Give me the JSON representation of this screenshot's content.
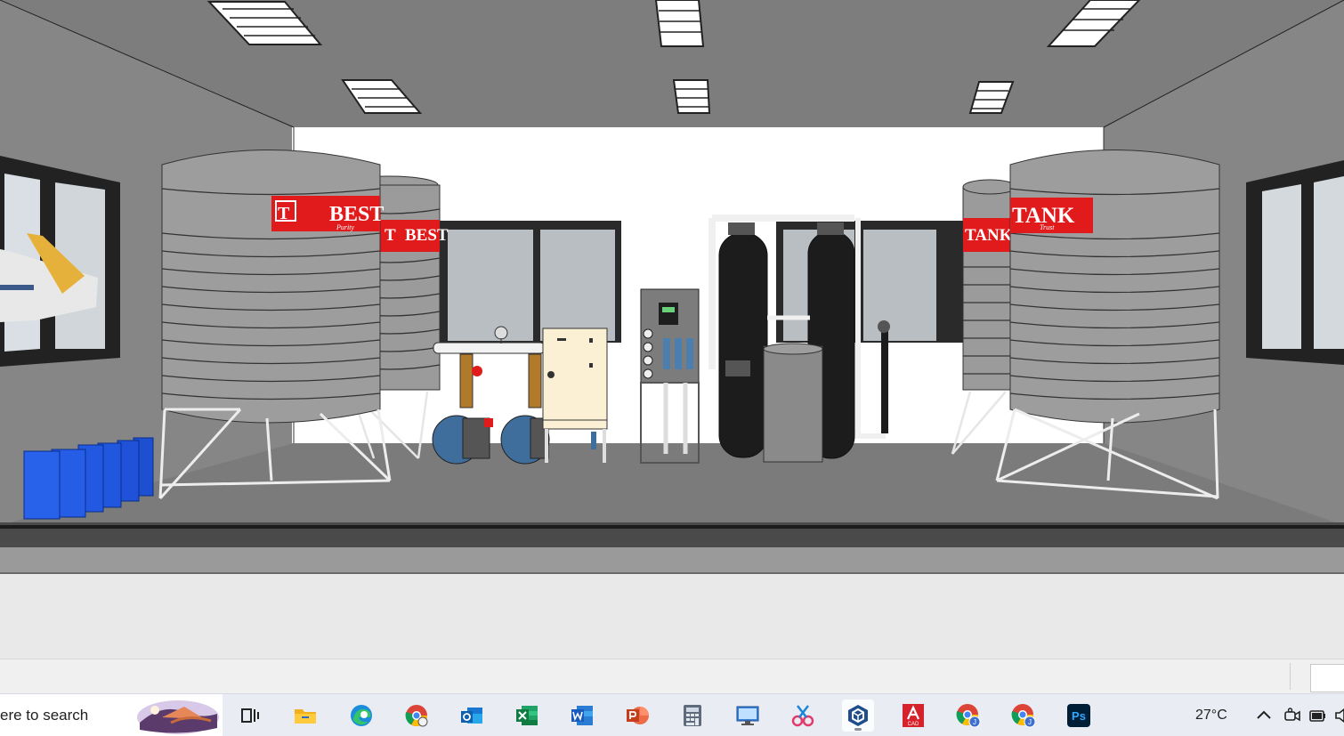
{
  "scene": {
    "tank_left_brand": "BEST",
    "tank_left_tagline": "Purity",
    "tank_right_brand": "TANK",
    "tank_right_tagline": "Trust"
  },
  "taskbar": {
    "search_text": "ere to search",
    "apps": [
      {
        "name": "task-view"
      },
      {
        "name": "file-explorer"
      },
      {
        "name": "edge"
      },
      {
        "name": "chrome-profile"
      },
      {
        "name": "outlook"
      },
      {
        "name": "excel"
      },
      {
        "name": "word"
      },
      {
        "name": "powerpoint"
      },
      {
        "name": "calculator"
      },
      {
        "name": "remote-desktop"
      },
      {
        "name": "snipping-tool"
      },
      {
        "name": "sketchup"
      },
      {
        "name": "autocad",
        "label": "CAD"
      },
      {
        "name": "chrome-user-1",
        "label": "J"
      },
      {
        "name": "chrome-user-2",
        "label": "J"
      },
      {
        "name": "photoshop",
        "label": "Ps"
      }
    ],
    "temperature": "27°C"
  }
}
